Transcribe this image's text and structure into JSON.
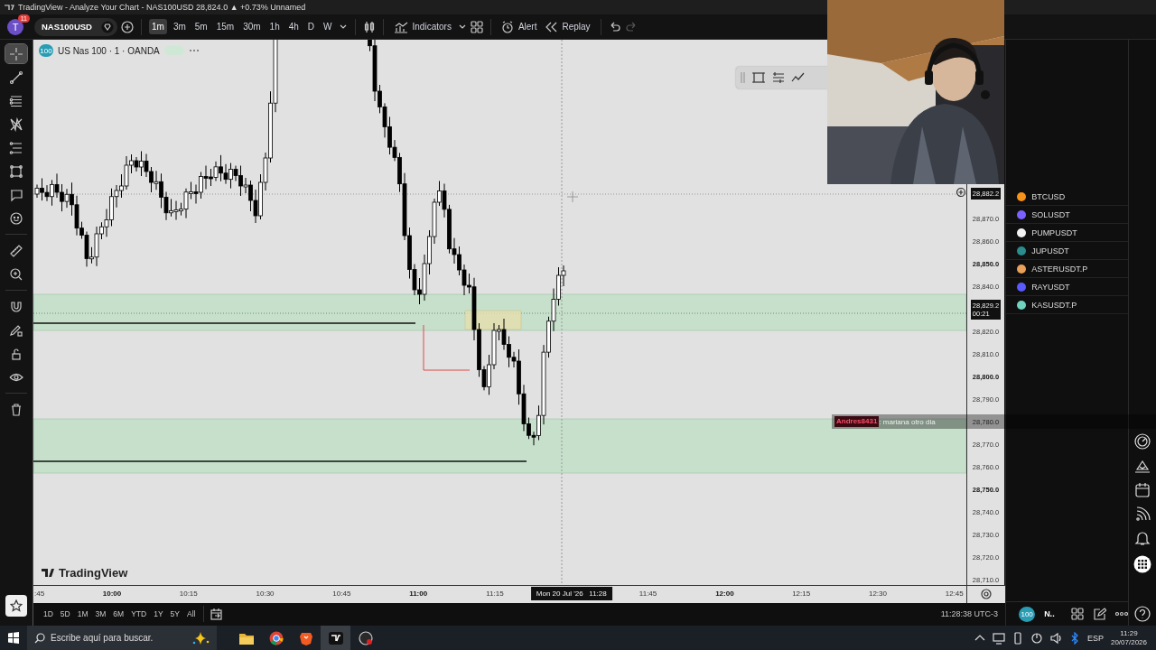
{
  "window": {
    "title": "TradingView - Analyze Your Chart - NAS100USD 28,824.0 ▲ +0.73% Unnamed"
  },
  "toolbar": {
    "avatar": "T",
    "notifications": "11",
    "symbol": "NAS100USD",
    "intervals": [
      {
        "label": "1m",
        "selected": true
      },
      {
        "label": "3m",
        "selected": false
      },
      {
        "label": "5m",
        "selected": false
      },
      {
        "label": "15m",
        "selected": false
      },
      {
        "label": "30m",
        "selected": false
      },
      {
        "label": "1h",
        "selected": false
      },
      {
        "label": "4h",
        "selected": false
      },
      {
        "label": "D",
        "selected": false
      },
      {
        "label": "W",
        "selected": false
      }
    ],
    "indicators": "Indicators",
    "alert": "Alert",
    "replay": "Replay"
  },
  "tools": [
    {
      "kind": "crosshair",
      "selected": true
    },
    {
      "kind": "trendline",
      "selected": false
    },
    {
      "kind": "fib",
      "selected": false
    },
    {
      "kind": "pattern",
      "selected": false
    },
    {
      "kind": "forecast",
      "selected": false
    },
    {
      "kind": "shape",
      "selected": false
    },
    {
      "kind": "comment",
      "selected": false
    },
    {
      "kind": "emoji",
      "selected": false
    },
    {
      "kind": "divider"
    },
    {
      "kind": "ruler",
      "selected": false
    },
    {
      "kind": "zoom",
      "selected": false
    },
    {
      "kind": "divider"
    },
    {
      "kind": "magnet",
      "selected": false
    },
    {
      "kind": "lockdraw",
      "selected": false
    },
    {
      "kind": "lock",
      "selected": false
    },
    {
      "kind": "eye",
      "selected": false
    },
    {
      "kind": "divider"
    },
    {
      "kind": "trash",
      "selected": false
    }
  ],
  "chart": {
    "legend": {
      "logo": "100",
      "symbol": "US Nas 100 · 1 · OANDA"
    },
    "watermark": "TradingView",
    "price_axis": [
      {
        "kind": "crosshair",
        "label": "28,882.2"
      },
      {
        "kind": "tick",
        "label": "28,870.0",
        "major": false
      },
      {
        "kind": "tick",
        "label": "28,860.0",
        "major": false
      },
      {
        "kind": "tick",
        "label": "28,850.0",
        "major": true
      },
      {
        "kind": "tick",
        "label": "28,840.0",
        "major": false
      },
      {
        "kind": "last",
        "label": "28,829.2",
        "countdown": "00:21"
      },
      {
        "kind": "tick",
        "label": "28,820.0",
        "major": false
      },
      {
        "kind": "tick",
        "label": "28,810.0",
        "major": false
      },
      {
        "kind": "tick",
        "label": "28,800.0",
        "major": true
      },
      {
        "kind": "tick",
        "label": "28,790.0",
        "major": false
      },
      {
        "kind": "tick",
        "label": "28,780.0",
        "major": false
      },
      {
        "kind": "tick",
        "label": "28,770.0",
        "major": false
      },
      {
        "kind": "tick",
        "label": "28,760.0",
        "major": false
      },
      {
        "kind": "tick",
        "label": "28,750.0",
        "major": true
      },
      {
        "kind": "tick",
        "label": "28,740.0",
        "major": false
      },
      {
        "kind": "tick",
        "label": "28,730.0",
        "major": false
      },
      {
        "kind": "tick",
        "label": "28,720.0",
        "major": false
      },
      {
        "kind": "tick",
        "label": "28,710.0",
        "major": false
      }
    ],
    "time_axis": [
      {
        "kind": "tick",
        "label": ":45",
        "major": false
      },
      {
        "kind": "tick",
        "label": "10:00",
        "major": true
      },
      {
        "kind": "tick",
        "label": "10:15",
        "major": false
      },
      {
        "kind": "tick",
        "label": "10:30",
        "major": false
      },
      {
        "kind": "tick",
        "label": "10:45",
        "major": false
      },
      {
        "kind": "tick",
        "label": "11:00",
        "major": true
      },
      {
        "kind": "tick",
        "label": "11:15",
        "major": false
      },
      {
        "kind": "crosshair",
        "label": "Mon 20 Jul '26   11:28"
      },
      {
        "kind": "tick",
        "label": "11:45",
        "major": false
      },
      {
        "kind": "tick",
        "label": "12:00",
        "major": true
      },
      {
        "kind": "tick",
        "label": "12:15",
        "major": false
      },
      {
        "kind": "tick",
        "label": "12:30",
        "major": false
      },
      {
        "kind": "tick",
        "label": "12:45",
        "major": false
      }
    ]
  },
  "chat": {
    "user": "Andres8431",
    "message": ": mariana otro dia"
  },
  "watchlist": [
    {
      "symbol": "BTCUSD",
      "color": "#f7931a"
    },
    {
      "symbol": "SOLUSDT",
      "color": "#7b61ff"
    },
    {
      "symbol": "PUMPUSDT",
      "color": "#f2f2f2"
    },
    {
      "symbol": "JUPUSDT",
      "color": "#2a8c8c"
    },
    {
      "symbol": "ASTERUSDT.P",
      "color": "#e8a05a"
    },
    {
      "symbol": "RAYUSDT",
      "color": "#5a5aff"
    },
    {
      "symbol": "KASUSDT.P",
      "color": "#6fd3c0"
    }
  ],
  "ranges": [
    "1D",
    "5D",
    "1M",
    "3M",
    "6M",
    "YTD",
    "1Y",
    "5Y",
    "All"
  ],
  "clock": "11:28:38 UTC-3",
  "panel_footer": {
    "badge": "100",
    "label": "N.."
  },
  "taskbar": {
    "search_placeholder": "Escribe aquí para buscar.",
    "language": "ESP",
    "time": "11:29",
    "date": "20/07/2026"
  }
}
